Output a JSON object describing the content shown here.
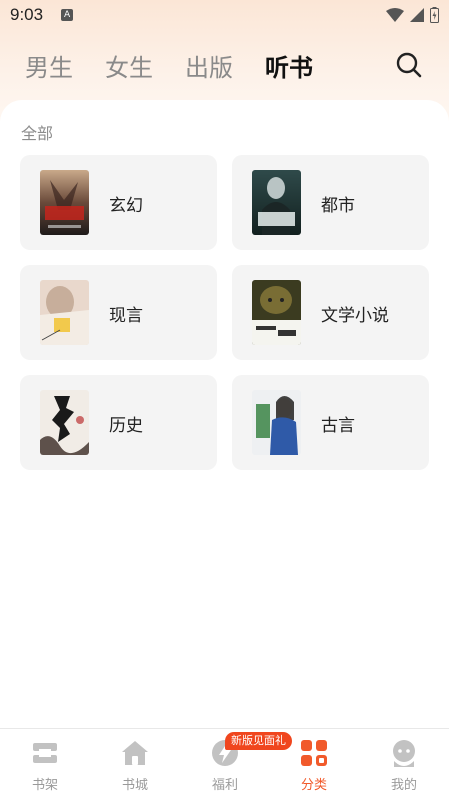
{
  "status_bar": {
    "time": "9:03",
    "notification_icon": "A"
  },
  "top_tabs": [
    {
      "label": "男生",
      "active": false
    },
    {
      "label": "女生",
      "active": false
    },
    {
      "label": "出版",
      "active": false
    },
    {
      "label": "听书",
      "active": true
    }
  ],
  "section": {
    "title": "全部"
  },
  "categories": [
    {
      "label": "玄幻",
      "cover_icon": "book-cover-fantasy"
    },
    {
      "label": "都市",
      "cover_icon": "book-cover-urban"
    },
    {
      "label": "现言",
      "cover_icon": "book-cover-modern-romance"
    },
    {
      "label": "文学小说",
      "cover_icon": "book-cover-literature"
    },
    {
      "label": "历史",
      "cover_icon": "book-cover-history"
    },
    {
      "label": "古言",
      "cover_icon": "book-cover-ancient-romance"
    }
  ],
  "bottom_nav": {
    "items": [
      {
        "label": "书架",
        "icon": "bookshelf-icon",
        "active": false
      },
      {
        "label": "书城",
        "icon": "bookstore-icon",
        "active": false
      },
      {
        "label": "福利",
        "icon": "bonus-icon",
        "active": false
      },
      {
        "label": "分类",
        "icon": "category-icon",
        "active": true
      },
      {
        "label": "我的",
        "icon": "profile-icon",
        "active": false
      }
    ],
    "promo_badge": "新版见面礼"
  },
  "colors": {
    "accent": "#f15a2b",
    "inactive": "#9a9a9a",
    "card_bg": "#f4f4f4"
  }
}
